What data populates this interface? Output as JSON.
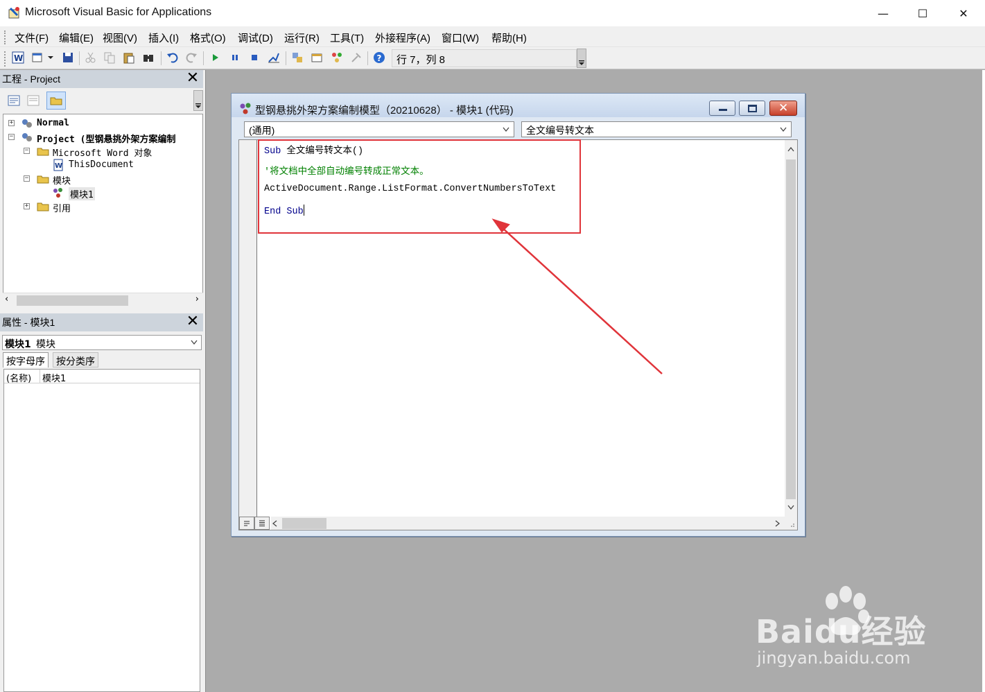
{
  "window": {
    "title": "Microsoft Visual Basic for Applications",
    "minimize": "—",
    "maximize": "☐",
    "close": "✕"
  },
  "menu": [
    "文件(F)",
    "编辑(E)",
    "视图(V)",
    "插入(I)",
    "格式(O)",
    "调试(D)",
    "运行(R)",
    "工具(T)",
    "外接程序(A)",
    "窗口(W)",
    "帮助(H)"
  ],
  "toolbar": {
    "position_text": "行 7，列 8",
    "buttons": [
      "word-icon",
      "insert-userform-icon",
      "save-icon",
      "cut-icon",
      "copy-icon",
      "paste-icon",
      "find-icon",
      "undo-icon",
      "redo-icon",
      "run-icon",
      "break-icon",
      "reset-icon",
      "design-mode-icon",
      "project-explorer-icon",
      "properties-icon",
      "object-browser-icon",
      "toolbox-icon",
      "help-icon"
    ]
  },
  "project_pane": {
    "title": "工程 - Project",
    "close": "✕",
    "tree": {
      "normal": "Normal",
      "project": "Project (型钢悬挑外架方案编制",
      "word_objects": "Microsoft Word 对象",
      "this_document": "ThisDocument",
      "modules": "模块",
      "module1": "模块1",
      "references": "引用"
    }
  },
  "properties_pane": {
    "title": "属性 - 模块1",
    "close": "✕",
    "combo_name": "模块1",
    "combo_type": "模块",
    "tabs": [
      "按字母序",
      "按分类序"
    ],
    "rows": [
      {
        "name": "(名称)",
        "value": "模块1"
      }
    ]
  },
  "code_window": {
    "title": "型钢悬挑外架方案编制模型（20210628） - 模块1 (代码)",
    "object_combo": "(通用)",
    "procedure_combo": "全文编号转文本",
    "lines": {
      "sub_kw": "Sub",
      "sub_name": " 全文编号转文本()",
      "comment": "'将文档中全部自动编号转成正常文本。",
      "statement": "ActiveDocument.Range.ListFormat.ConvertNumbersToText",
      "end_sub": "End Sub"
    }
  },
  "watermark": {
    "brand": "Bai",
    "brand_tail": "du经验",
    "url": "jingyan.baidu.com"
  },
  "colors": {
    "highlight": "#e0343a",
    "keyword": "#00008b",
    "comment": "#008000",
    "workspace": "#ababab"
  }
}
